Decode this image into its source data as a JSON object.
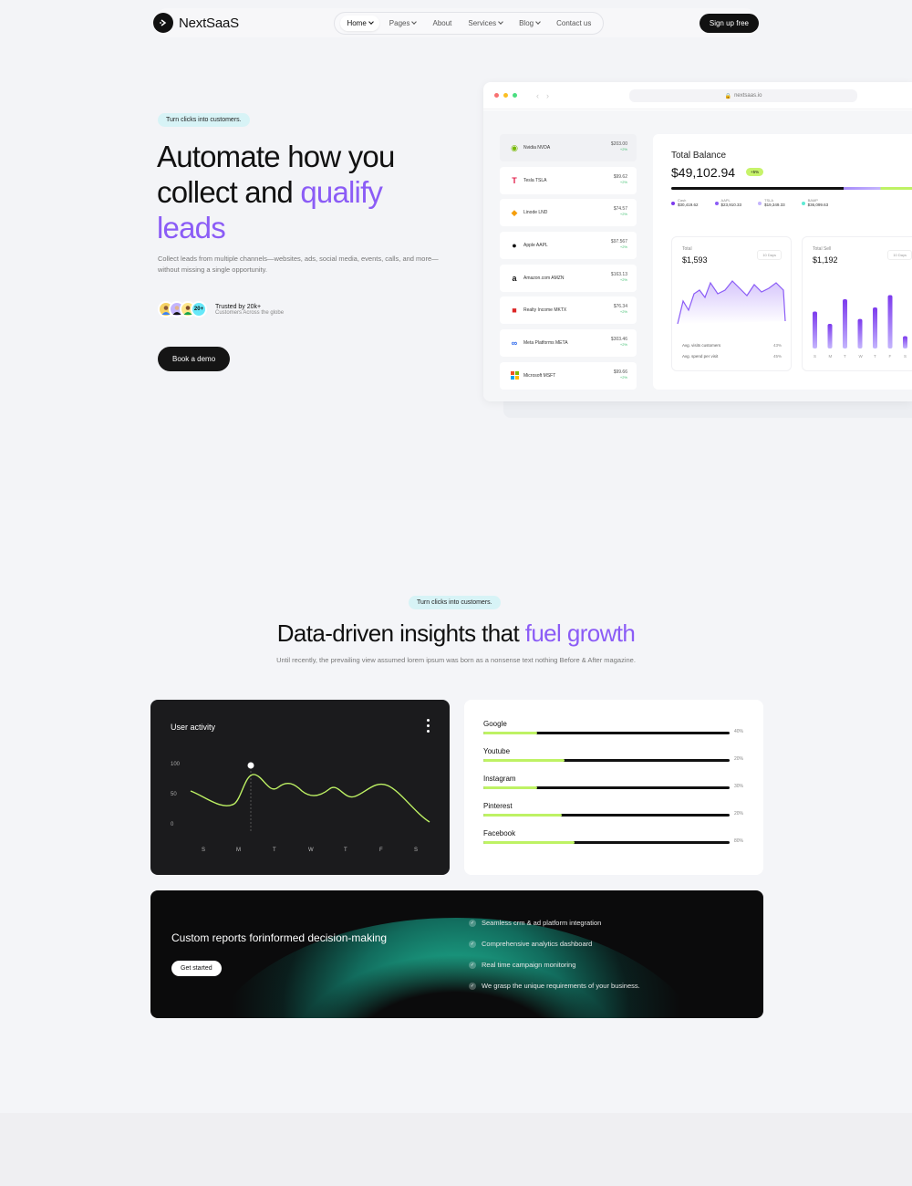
{
  "brand": {
    "name": "NextSaaS"
  },
  "nav": {
    "items": [
      {
        "label": "Home",
        "dropdown": true,
        "active": true
      },
      {
        "label": "Pages",
        "dropdown": true
      },
      {
        "label": "About"
      },
      {
        "label": "Services",
        "dropdown": true
      },
      {
        "label": "Blog",
        "dropdown": true
      },
      {
        "label": "Contact us"
      }
    ],
    "signup_label": "Sign up free"
  },
  "hero": {
    "badge": "Turn clicks into customers.",
    "title_line1": "Automate how you",
    "title_line2_plain": "collect and ",
    "title_line2_accent": "qualify",
    "title_line3_accent": "leads",
    "description": "Collect leads from multiple channels—websites, ads, social media, events, calls, and more—without missing a single opportunity.",
    "trusted_title": "Trusted by 20k+",
    "trusted_sub": "Customers Across the globe",
    "avatar_count": "20+",
    "cta_label": "Book a demo"
  },
  "browser": {
    "url": "nextsaas.io",
    "stocks": [
      {
        "name": "Nvidia NVDA",
        "price": "$203.00",
        "change": "+2%",
        "icon": "nvidia-icon"
      },
      {
        "name": "Tesla TSLA",
        "price": "$99.62",
        "change": "+2%",
        "icon": "tesla-icon"
      },
      {
        "name": "Linode LND",
        "price": "$74.57",
        "change": "+2%",
        "icon": "linode-icon"
      },
      {
        "name": "Apple AAPL",
        "price": "$97.567",
        "change": "+2%",
        "icon": "apple-icon"
      },
      {
        "name": "Amazon.com AMZN",
        "price": "$163.13",
        "change": "+2%",
        "icon": "amazon-icon"
      },
      {
        "name": "Realty Income MKTX",
        "price": "$76.34",
        "change": "+2%",
        "icon": "realty-icon"
      },
      {
        "name": "Meta Platforms META",
        "price": "$303.46",
        "change": "+2%",
        "icon": "meta-icon"
      },
      {
        "name": "Microsoft MSFT",
        "price": "$99.66",
        "change": "+2%",
        "icon": "microsoft-icon"
      }
    ],
    "balance": {
      "title": "Total Balance",
      "value": "$49,102.94",
      "pill": "+5%",
      "legend": [
        {
          "name": "Cash",
          "value": "$30,419.62",
          "color": "#7c3aed"
        },
        {
          "name": "AAPL",
          "value": "$23,910.33",
          "color": "#8b5cf6"
        },
        {
          "name": "TSLA",
          "value": "$19,349.33",
          "color": "#c4b5fd"
        },
        {
          "name": "BAMP",
          "value": "$36,099.63",
          "color": "#5eead4"
        }
      ]
    },
    "mini_line": {
      "label": "Total",
      "value": "$1,593",
      "select": "10 Days",
      "foot1_label": "Avg. visits customers",
      "foot1_value": "43%",
      "foot2_label": "Avg. spend per visit",
      "foot2_value": "45%"
    },
    "mini_bar": {
      "label": "Total Sell",
      "value": "$1,192",
      "select": "10 Days",
      "days": [
        "S",
        "M",
        "T",
        "W",
        "T",
        "F",
        "S"
      ],
      "heights": [
        0.45,
        0.3,
        0.6,
        0.36,
        0.5,
        0.65,
        0.15
      ]
    }
  },
  "section2": {
    "badge": "Turn clicks into customers.",
    "title_plain": "Data-driven insights that ",
    "title_accent": "fuel growth",
    "description": "Until recently, the prevailing view assumed lorem ipsum was born as a nonsense text nothing Before & After magazine."
  },
  "activity": {
    "title": "User activity",
    "y_ticks": [
      "100",
      "50",
      "0"
    ],
    "days": [
      "S",
      "M",
      "T",
      "W",
      "T",
      "F",
      "S"
    ]
  },
  "sources": [
    {
      "name": "Google",
      "percent": 0.22,
      "label": "40%"
    },
    {
      "name": "Youtube",
      "percent": 0.33,
      "label": "20%"
    },
    {
      "name": "Instagram",
      "percent": 0.22,
      "label": "30%"
    },
    {
      "name": "Pinterest",
      "percent": 0.32,
      "label": "20%"
    },
    {
      "name": "Facebook",
      "percent": 0.37,
      "label": "80%"
    }
  ],
  "cta": {
    "title": "Custom reports forinformed decision-making",
    "button": "Get started",
    "features": [
      "Seamless crm & ad platform integration",
      "Comprehensive analytics dashboard",
      "Real time campaign monitoring",
      "We grasp the unique requirements of your business."
    ]
  }
}
